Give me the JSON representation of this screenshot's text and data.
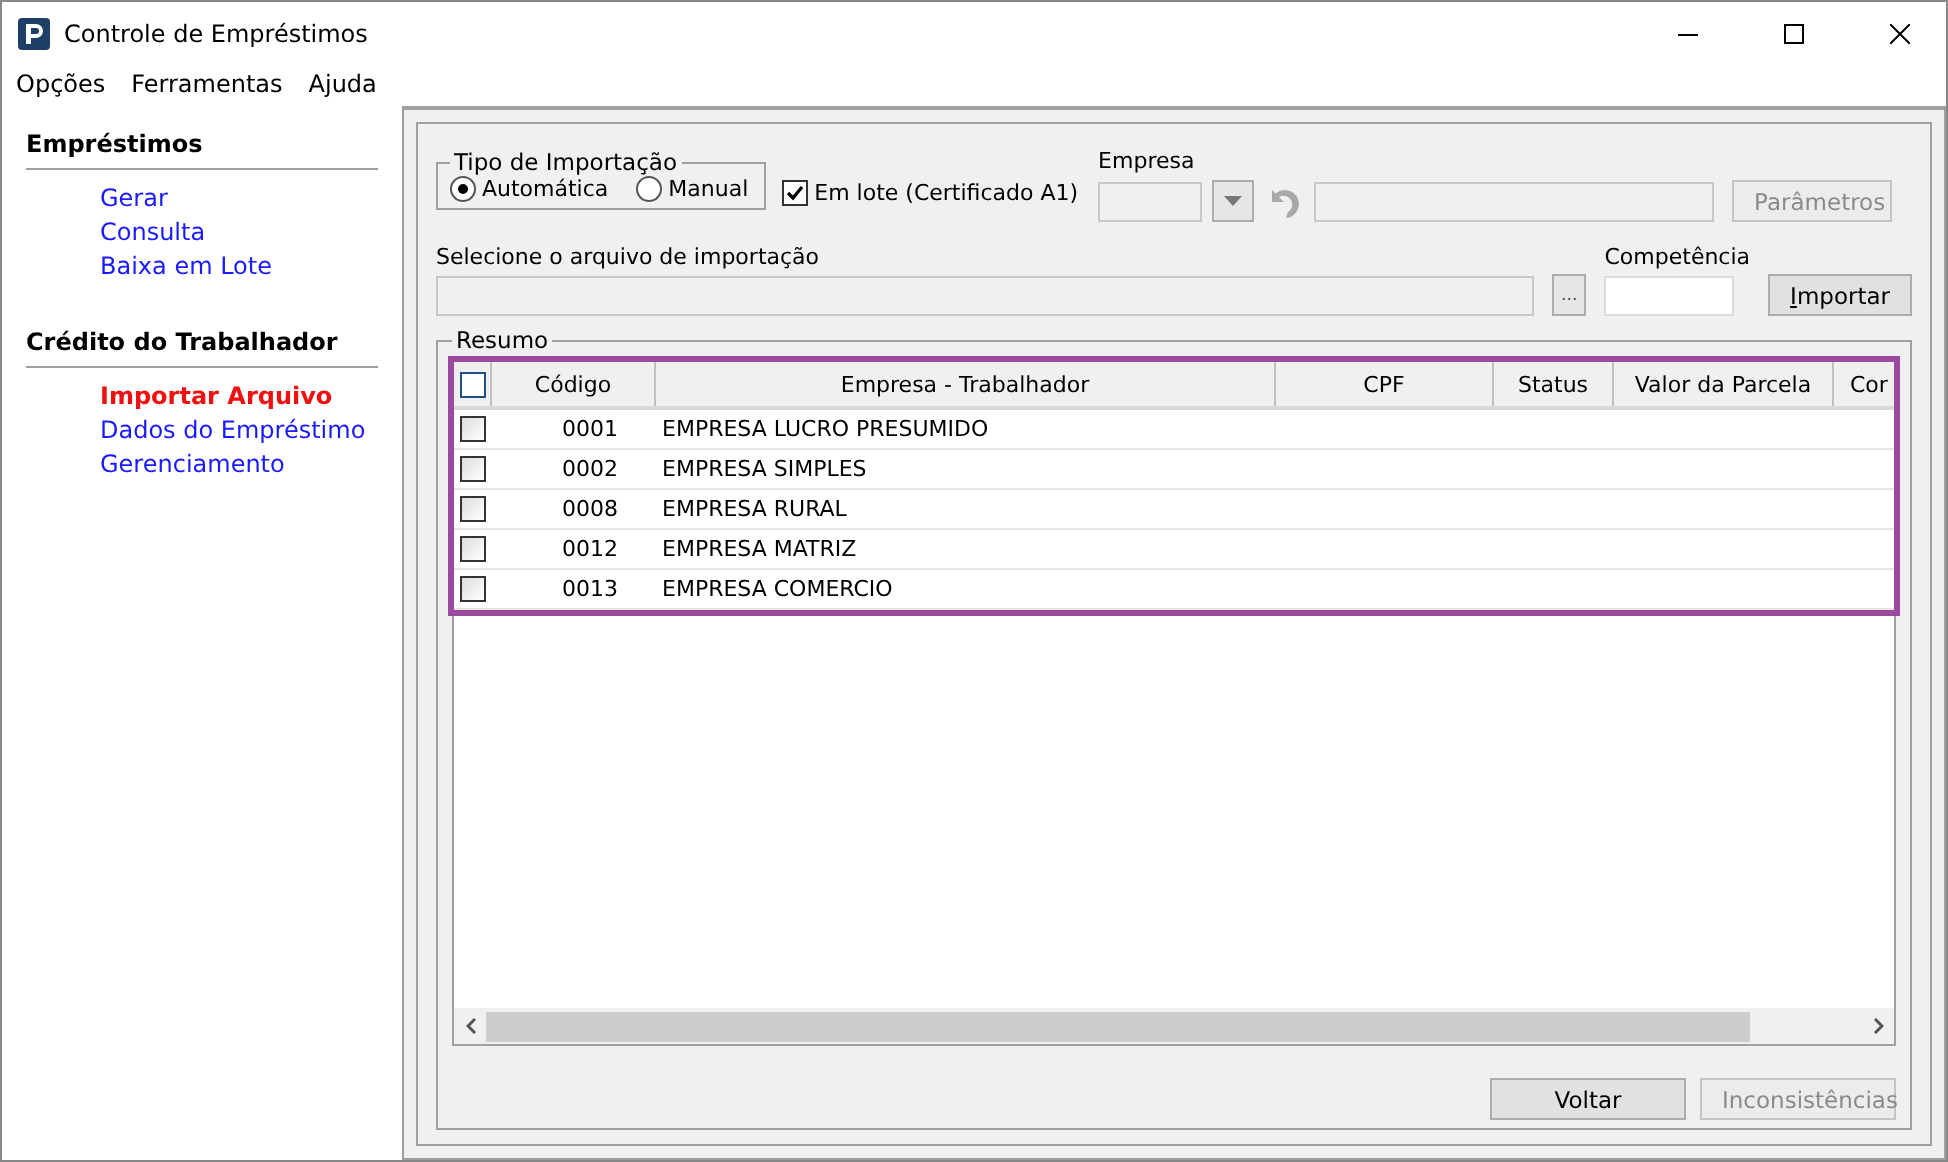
{
  "window": {
    "title": "Controle de Empréstimos"
  },
  "menu": [
    "Opções",
    "Ferramentas",
    "Ajuda"
  ],
  "sidebar": [
    {
      "heading": "Empréstimos",
      "items": [
        {
          "label": "Gerar",
          "selected": false
        },
        {
          "label": "Consulta",
          "selected": false
        },
        {
          "label": "Baixa em Lote",
          "selected": false
        }
      ]
    },
    {
      "heading": "Crédito do Trabalhador",
      "items": [
        {
          "label": "Importar Arquivo",
          "selected": true
        },
        {
          "label": "Dados do Empréstimo",
          "selected": false
        },
        {
          "label": "Gerenciamento",
          "selected": false
        }
      ]
    }
  ],
  "import_type": {
    "legend": "Tipo de Importação",
    "options": [
      {
        "label": "Automática",
        "selected": true
      },
      {
        "label": "Manual",
        "selected": false
      }
    ]
  },
  "batch": {
    "label": "Em lote (Certificado A1)",
    "checked": true
  },
  "empresa": {
    "label": "Empresa",
    "disabled": true
  },
  "parametros_button": {
    "label": "Parâmetros",
    "disabled": true
  },
  "file": {
    "label": "Selecione o arquivo de importação",
    "browse": "..."
  },
  "competencia": {
    "label": "Competência"
  },
  "importar_button": {
    "label": "Importar",
    "disabled": false
  },
  "resumo": {
    "legend": "Resumo",
    "columns": [
      "Código",
      "Empresa - Trabalhador",
      "CPF",
      "Status",
      "Valor da Parcela",
      "Cor"
    ],
    "header_checked": false,
    "rows": [
      {
        "checked": false,
        "code": "0001",
        "name": "EMPRESA LUCRO PRESUMIDO"
      },
      {
        "checked": false,
        "code": "0002",
        "name": "EMPRESA SIMPLES"
      },
      {
        "checked": false,
        "code": "0008",
        "name": "EMPRESA RURAL"
      },
      {
        "checked": false,
        "code": "0012",
        "name": "EMPRESA MATRIZ"
      },
      {
        "checked": false,
        "code": "0013",
        "name": "EMPRESA COMERCIO"
      }
    ]
  },
  "buttons": [
    {
      "label": "Voltar",
      "disabled": false
    },
    {
      "label": "Inconsistências",
      "disabled": true
    }
  ]
}
